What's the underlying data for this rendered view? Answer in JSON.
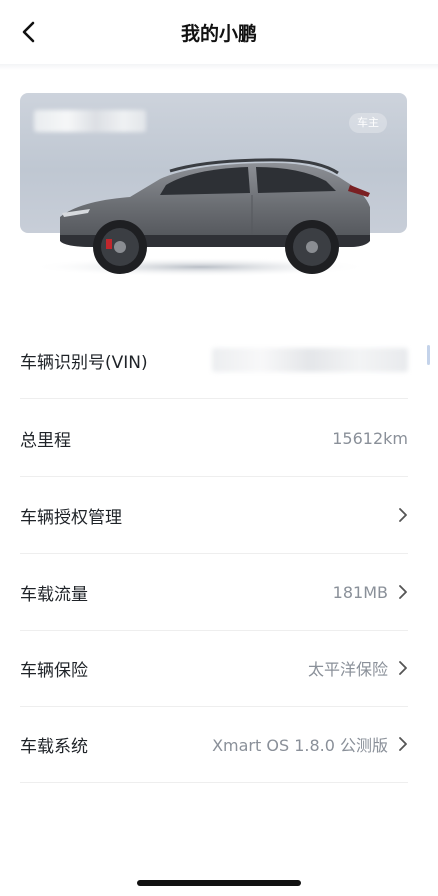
{
  "nav": {
    "title": "我的小鹏"
  },
  "vehicle": {
    "owner_badge": "车主"
  },
  "rows": [
    {
      "label": "车辆识别号(VIN)",
      "value": ""
    },
    {
      "label": "总里程",
      "value": "15612km"
    },
    {
      "label": "车辆授权管理",
      "value": ""
    },
    {
      "label": "车载流量",
      "value": "181MB"
    },
    {
      "label": "车辆保险",
      "value": "太平洋保险"
    },
    {
      "label": "车载系统",
      "value": "Xmart OS 1.8.0 公测版"
    }
  ],
  "icons": {
    "back": "chevron-left-icon",
    "row_arrow": "chevron-right-icon"
  },
  "colors": {
    "card_bg": "#c4ccd6",
    "value_text": "#8a9099",
    "divider": "#eeeeee"
  }
}
